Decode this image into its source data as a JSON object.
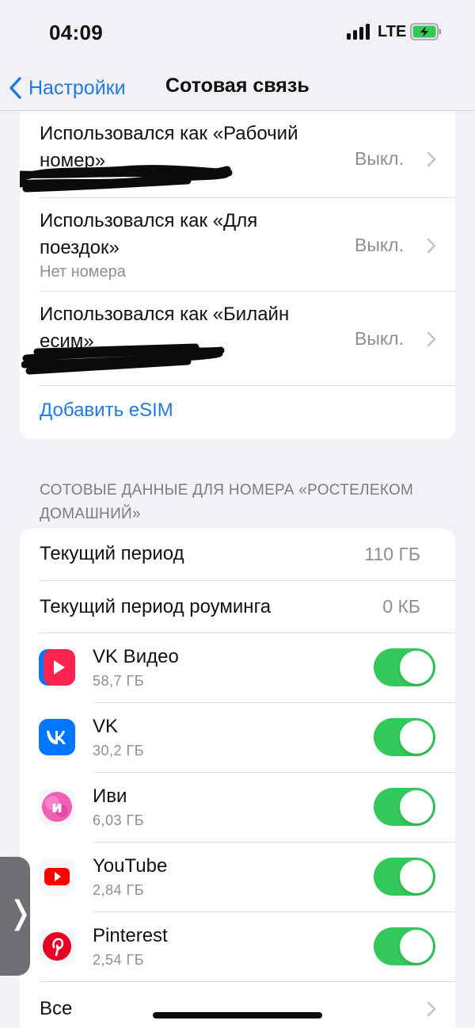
{
  "status_bar": {
    "time": "04:09",
    "network": "LTE"
  },
  "nav": {
    "back_label": "Настройки",
    "title": "Сотовая связь"
  },
  "lines": [
    {
      "label": "Использовался как «Рабочий номер»",
      "label_line1": "Использовался как «Рабочий",
      "label_line2": "номер»",
      "value": "Выкл.",
      "sub": ""
    },
    {
      "label": "Использовался как «Для поездок»",
      "label_line1": "Использовался как «Для",
      "label_line2": "поездок»",
      "value": "Выкл.",
      "sub": "Нет номера"
    },
    {
      "label": "Использовался как «Билайн есим»",
      "label_line1": "Использовался как «Билайн",
      "label_line2": "есим»",
      "value": "Выкл.",
      "sub": ""
    }
  ],
  "add_esim_label": "Добавить eSIM",
  "data_section": {
    "header_line1": "СОТОВЫЕ ДАННЫЕ ДЛЯ НОМЕРА «РОСТЕЛЕКОМ",
    "header_line2": "ДОМАШНИЙ»",
    "current_period": {
      "label": "Текущий период",
      "value": "110 ГБ"
    },
    "roaming_period": {
      "label": "Текущий период роуминга",
      "value": "0 КБ"
    },
    "apps": [
      {
        "name": "VK Видео",
        "usage": "58,7 ГБ",
        "icon": "vk-video-icon",
        "enabled": true
      },
      {
        "name": "VK",
        "usage": "30,2 ГБ",
        "icon": "vk-icon",
        "enabled": true
      },
      {
        "name": "Иви",
        "usage": "6,03 ГБ",
        "icon": "ivi-icon",
        "enabled": true
      },
      {
        "name": "YouTube",
        "usage": "2,84 ГБ",
        "icon": "youtube-icon",
        "enabled": true
      },
      {
        "name": "Pinterest",
        "usage": "2,54 ГБ",
        "icon": "pinterest-icon",
        "enabled": true
      }
    ],
    "all_label": "Все"
  },
  "colors": {
    "accent": "#1f7ae0",
    "toggle_on": "#34c759",
    "background": "#f2f2f6"
  }
}
